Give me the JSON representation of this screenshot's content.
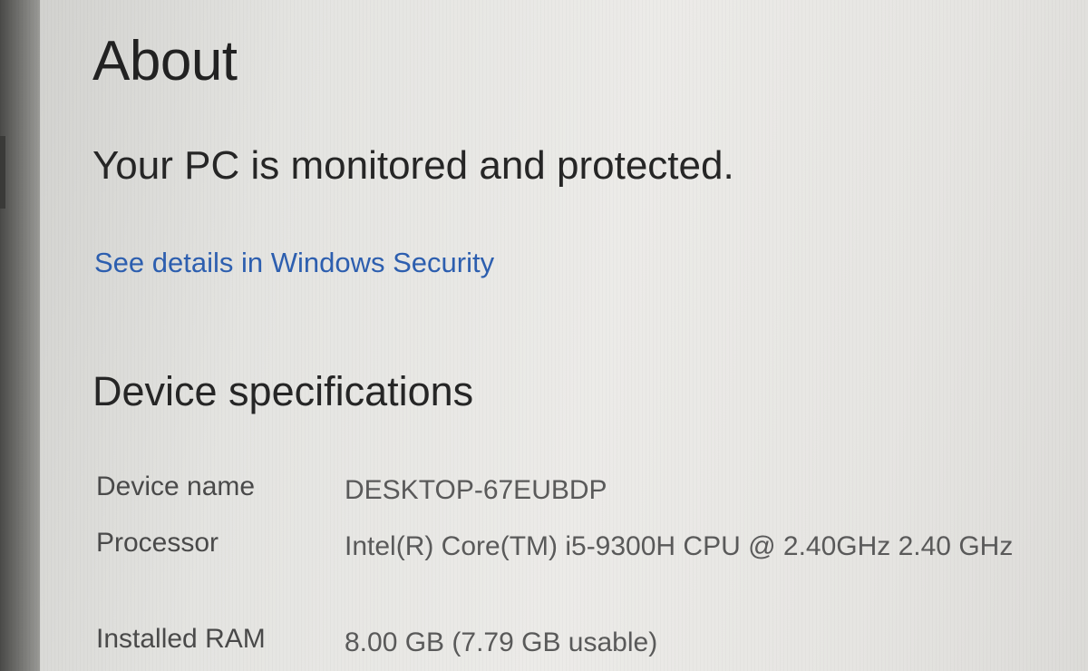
{
  "page": {
    "title": "About"
  },
  "security": {
    "status": "Your PC is monitored and protected.",
    "link_label": "See details in Windows Security",
    "link_color": "#2d5fb0"
  },
  "device_specifications": {
    "heading": "Device specifications",
    "rows": [
      {
        "label": "Device name",
        "value": "DESKTOP-67EUBDP"
      },
      {
        "label": "Processor",
        "value": "Intel(R) Core(TM) i5-9300H CPU @ 2.40GHz   2.40 GHz"
      },
      {
        "label": "Installed RAM",
        "value": "8.00 GB (7.79 GB usable)"
      }
    ]
  }
}
